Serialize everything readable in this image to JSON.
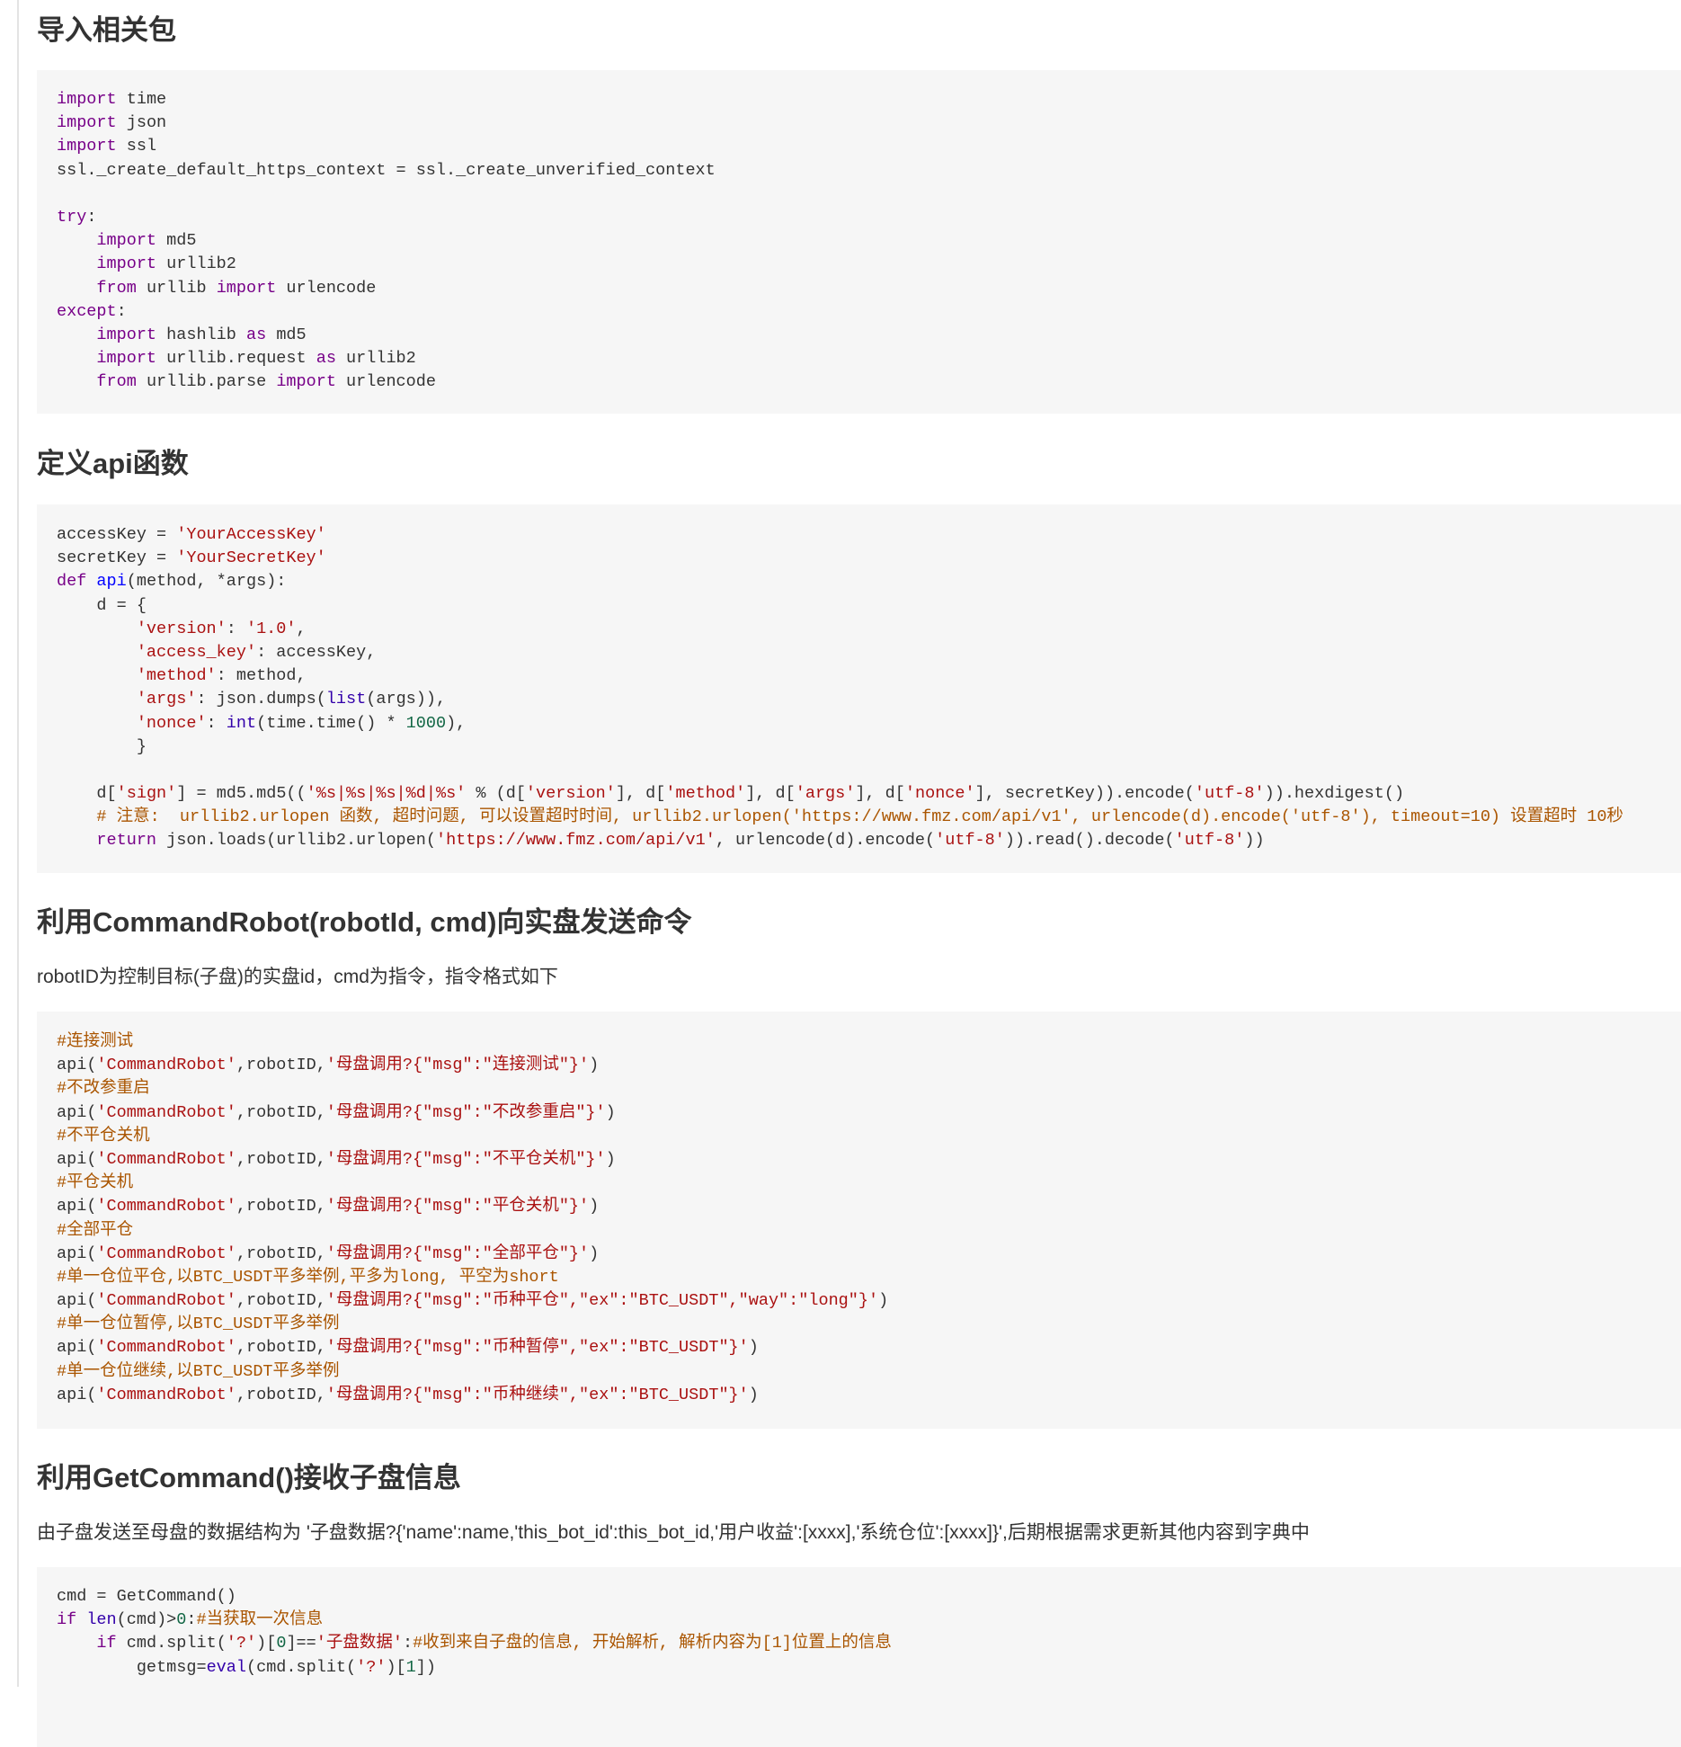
{
  "sections": {
    "import": {
      "title": "导入相关包",
      "code": [
        "import time",
        "import json",
        "import ssl",
        "ssl._create_default_https_context = ssl._create_unverified_context",
        "",
        "try:",
        "    import md5",
        "    import urllib2",
        "    from urllib import urlencode",
        "except:",
        "    import hashlib as md5",
        "    import urllib.request as urllib2",
        "    from urllib.parse import urlencode"
      ]
    },
    "api": {
      "title": "定义api函数",
      "code": [
        "accessKey = 'YourAccessKey'",
        "secretKey = 'YourSecretKey'",
        "def api(method, *args):",
        "    d = {",
        "        'version': '1.0',",
        "        'access_key': accessKey,",
        "        'method': method,",
        "        'args': json.dumps(list(args)),",
        "        'nonce': int(time.time() * 1000),",
        "        }",
        "",
        "    d['sign'] = md5.md5(('%s|%s|%s|%d|%s' % (d['version'], d['method'], d['args'], d['nonce'], secretKey)).encode('utf-8')).hexdigest()",
        "    # 注意:  urllib2.urlopen 函数, 超时问题, 可以设置超时时间, urllib2.urlopen('https://www.fmz.com/api/v1', urlencode(d).encode('utf-8'), timeout=10) 设置超时 10秒",
        "    return json.loads(urllib2.urlopen('https://www.fmz.com/api/v1', urlencode(d).encode('utf-8')).read().decode('utf-8'))"
      ]
    },
    "command_robot": {
      "title": "利用CommandRobot(robotId, cmd)向实盘发送命令",
      "description": "robotID为控制目标(子盘)的实盘id，cmd为指令，指令格式如下",
      "code": [
        "#连接测试",
        "api('CommandRobot',robotID,'母盘调用?{\"msg\":\"连接测试\"}')",
        "#不改参重启",
        "api('CommandRobot',robotID,'母盘调用?{\"msg\":\"不改参重启\"}')",
        "#不平仓关机",
        "api('CommandRobot',robotID,'母盘调用?{\"msg\":\"不平仓关机\"}')",
        "#平仓关机",
        "api('CommandRobot',robotID,'母盘调用?{\"msg\":\"平仓关机\"}')",
        "#全部平仓",
        "api('CommandRobot',robotID,'母盘调用?{\"msg\":\"全部平仓\"}')",
        "#单一仓位平仓,以BTC_USDT平多举例,平多为long, 平空为short",
        "api('CommandRobot',robotID,'母盘调用?{\"msg\":\"币种平仓\",\"ex\":\"BTC_USDT\",\"way\":\"long\"}')",
        "#单一仓位暂停,以BTC_USDT平多举例",
        "api('CommandRobot',robotID,'母盘调用?{\"msg\":\"币种暂停\",\"ex\":\"BTC_USDT\"}')",
        "#单一仓位继续,以BTC_USDT平多举例",
        "api('CommandRobot',robotID,'母盘调用?{\"msg\":\"币种继续\",\"ex\":\"BTC_USDT\"}')"
      ]
    },
    "get_command": {
      "title": "利用GetCommand()接收子盘信息",
      "description": "由子盘发送至母盘的数据结构为 '子盘数据?{'name':name,'this_bot_id':this_bot_id,'用户收益':[xxxx],'系统仓位':[xxxx]}',后期根据需求更新其他内容到字典中",
      "code": [
        "cmd = GetCommand()",
        "if len(cmd)>0:#当获取一次信息",
        "    if cmd.split('?')[0]=='子盘数据':#收到来自子盘的信息, 开始解析, 解析内容为[1]位置上的信息",
        "        getmsg=eval(cmd.split('?')[1])"
      ]
    }
  },
  "colors": {
    "keyword": "#770088",
    "def_name": "#0000ff",
    "builtin": "#3300aa",
    "string": "#aa1111",
    "number": "#116644",
    "comment": "#aa5500",
    "code_bg": "#f6f6f6"
  }
}
